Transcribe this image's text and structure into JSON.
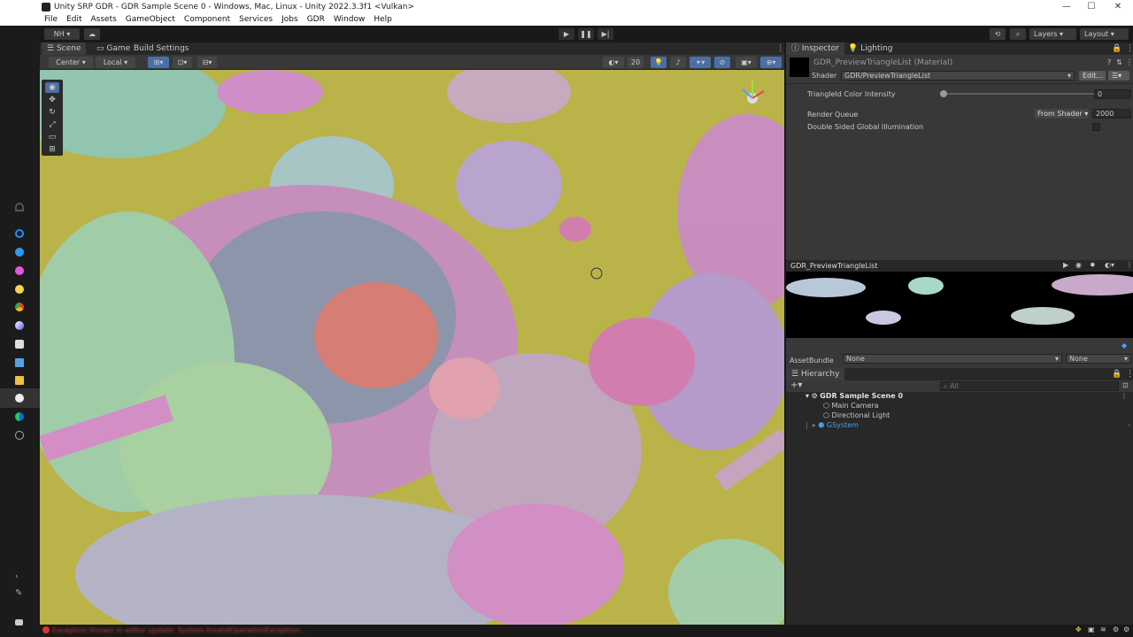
{
  "window": {
    "title": "Unity SRP GDR - GDR Sample Scene 0 - Windows, Mac, Linux - Unity 2022.3.3f1 <Vulkan>",
    "minimize": "—",
    "maximize": "☐",
    "close": "✕"
  },
  "menu": [
    "File",
    "Edit",
    "Assets",
    "GameObject",
    "Component",
    "Services",
    "Jobs",
    "GDR",
    "Window",
    "Help"
  ],
  "toolbar": {
    "account": "NH",
    "layers": "Layers",
    "layout": "Layout"
  },
  "scene": {
    "tabs": [
      "Scene",
      "Game",
      "Build Settings"
    ],
    "pivot": "Center",
    "space": "Local",
    "grid_value": "20"
  },
  "inspector": {
    "tabs": [
      "Inspector",
      "Lighting"
    ],
    "material_name": "GDR_PreviewTriangleList (Material)",
    "shader_label": "Shader",
    "shader_value": "GDR/PreviewTriangleList",
    "edit_button": "Edit...",
    "props": {
      "intensity_label": "TriangleId Color Intensity",
      "intensity_value": "0",
      "intensity_fraction": 0,
      "render_queue_label": "Render Queue",
      "render_queue_mode": "From Shader",
      "render_queue_value": "2000",
      "double_sided_label": "Double Sided Global Illumination"
    },
    "preview_title": "GDR_PreviewTriangleList",
    "assetbundle_label": "AssetBundle",
    "assetbundle_value": "None",
    "assetbundle_variant": "None"
  },
  "hierarchy": {
    "title": "Hierarchy",
    "search_placeholder": "All",
    "add": "+",
    "items": [
      {
        "label": "GDR Sample Scene 0"
      },
      {
        "label": "Main Camera"
      },
      {
        "label": "Directional Light"
      },
      {
        "label": "GSystem"
      }
    ]
  },
  "status": {
    "error": "Exception thrown in editor update: System.InvalidOperationException..."
  },
  "colors": {
    "viewport_bg": "#b9b34a",
    "accent": "#4aa3ff",
    "gsystem": "#5fb3f5"
  }
}
